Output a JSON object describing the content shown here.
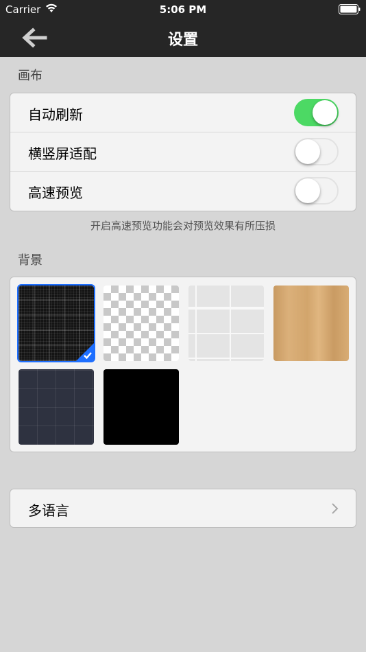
{
  "status_bar": {
    "carrier": "Carrier",
    "time": "5:06 PM"
  },
  "nav": {
    "title": "设置",
    "back_icon": "back-arrow-icon"
  },
  "canvas_section": {
    "header": "画布",
    "rows": [
      {
        "label": "自动刷新",
        "enabled": true
      },
      {
        "label": "横竖屏适配",
        "enabled": false
      },
      {
        "label": "高速预览",
        "enabled": false
      }
    ],
    "note": "开启高速预览功能会对预览效果有所压损"
  },
  "background_section": {
    "header": "背景",
    "swatches": [
      "dark-grid",
      "transparent-checker",
      "white-tile",
      "wood",
      "navy-grid",
      "black"
    ],
    "selected": "dark-grid"
  },
  "language_row": {
    "label": "多语言"
  },
  "colors": {
    "switch_on": "#4cd964",
    "selection": "#1e6fff",
    "nav_bg": "#262626"
  }
}
